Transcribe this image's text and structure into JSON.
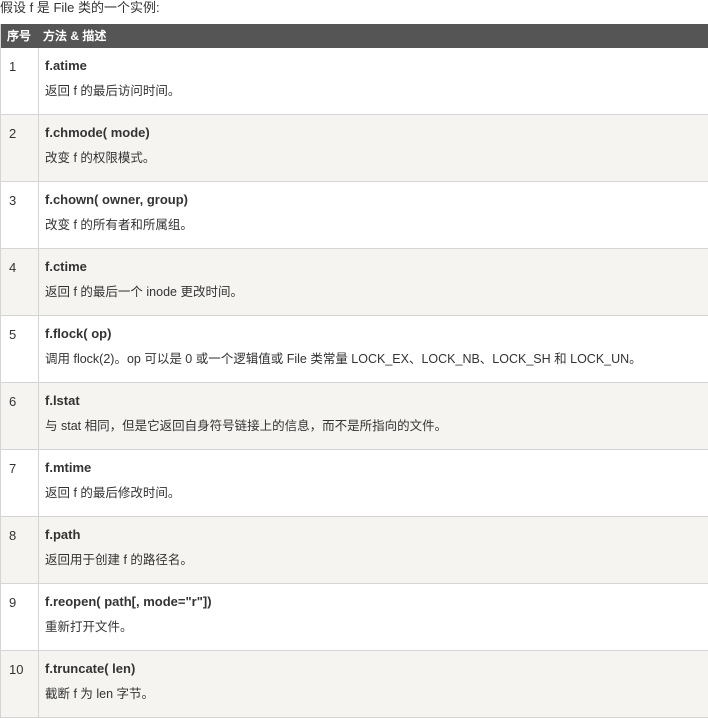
{
  "intro": "假设 f 是 File 类的一个实例:",
  "table": {
    "headers": [
      "序号",
      "方法 & 描述"
    ],
    "rows": [
      {
        "num": "1",
        "method": "f.atime",
        "desc": "返回 f 的最后访问时间。"
      },
      {
        "num": "2",
        "method": "f.chmode( mode)",
        "desc": "改变 f 的权限模式。"
      },
      {
        "num": "3",
        "method": "f.chown( owner, group)",
        "desc": "改变 f 的所有者和所属组。"
      },
      {
        "num": "4",
        "method": "f.ctime",
        "desc": "返回 f 的最后一个 inode 更改时间。"
      },
      {
        "num": "5",
        "method": "f.flock( op)",
        "desc": "调用 flock(2)。op 可以是 0 或一个逻辑值或 File 类常量 LOCK_EX、LOCK_NB、LOCK_SH 和 LOCK_UN。"
      },
      {
        "num": "6",
        "method": "f.lstat",
        "desc": "与 stat 相同，但是它返回自身符号链接上的信息，而不是所指向的文件。"
      },
      {
        "num": "7",
        "method": "f.mtime",
        "desc": "返回 f 的最后修改时间。"
      },
      {
        "num": "8",
        "method": "f.path",
        "desc": "返回用于创建 f 的路径名。"
      },
      {
        "num": "9",
        "method": "f.reopen( path[, mode=\"r\"])",
        "desc": "重新打开文件。"
      },
      {
        "num": "10",
        "method": "f.truncate( len)",
        "desc": "截断 f 为 len 字节。"
      }
    ]
  }
}
